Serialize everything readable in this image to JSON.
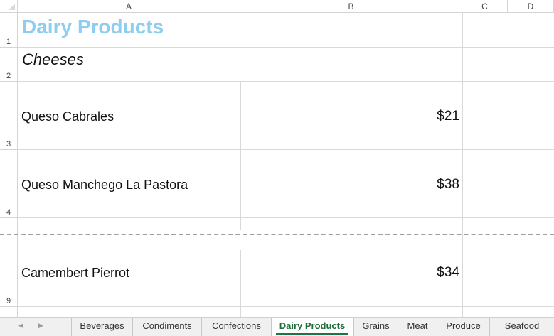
{
  "columns": [
    "A",
    "B",
    "C",
    "D"
  ],
  "rows": {
    "r1": "1",
    "r2": "2",
    "r3": "3",
    "r4": "4",
    "r9": "9"
  },
  "sheet": {
    "title": "Dairy Products",
    "category": "Cheeses",
    "products": [
      {
        "name": "Queso Cabrales",
        "price": "$21"
      },
      {
        "name": "Queso Manchego La Pastora",
        "price": "$38"
      },
      {
        "name": "Camembert Pierrot",
        "price": "$34"
      }
    ]
  },
  "tabs": [
    "Beverages",
    "Condiments",
    "Confections",
    "Dairy Products",
    "Grains",
    "Meat",
    "Produce",
    "Seafood"
  ],
  "active_tab": "Dairy Products",
  "colors": {
    "title": "#8ccdf0",
    "active_tab_accent": "#217346"
  }
}
